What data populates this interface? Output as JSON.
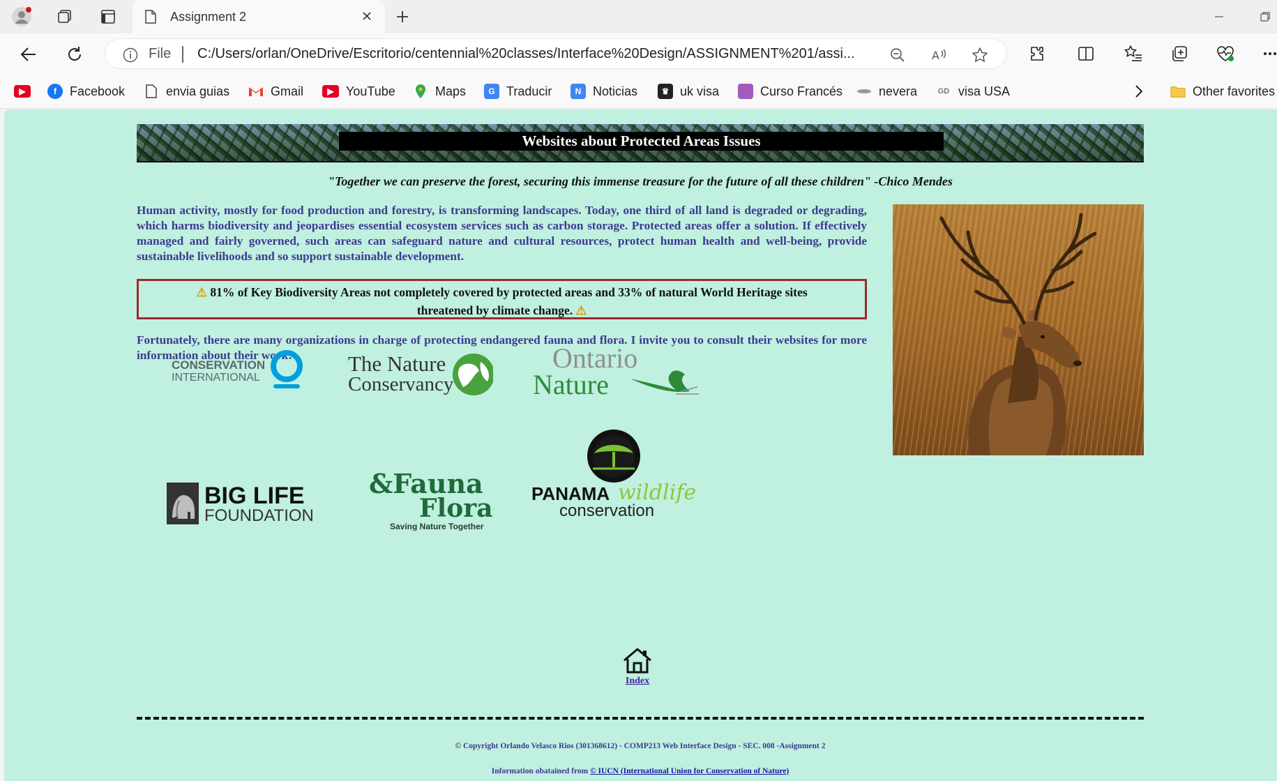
{
  "browser": {
    "tab_title": "Assignment 2",
    "omnibox": {
      "scheme_label": "File",
      "url": "C:/Users/orlan/OneDrive/Escritorio/centennial%20classes/Interface%20Design/ASSIGNMENT%201/assi..."
    },
    "favorites": [
      {
        "label": "Facebook",
        "icon": "facebook-icon"
      },
      {
        "label": "envia guias",
        "icon": "page-icon"
      },
      {
        "label": "Gmail",
        "icon": "gmail-icon"
      },
      {
        "label": "YouTube",
        "icon": "youtube-icon"
      },
      {
        "label": "Maps",
        "icon": "maps-icon"
      },
      {
        "label": "Traducir",
        "icon": "translate-icon"
      },
      {
        "label": "Noticias",
        "icon": "news-icon"
      },
      {
        "label": "uk visa",
        "icon": "uk-visa-icon"
      },
      {
        "label": "Curso Francés",
        "icon": "course-icon"
      },
      {
        "label": "nevera",
        "icon": "nevera-icon"
      },
      {
        "label": "visa USA",
        "icon": "visa-usa-icon"
      }
    ],
    "other_favorites": "Other favorites"
  },
  "page": {
    "banner_title": "Websites about Protected Areas Issues",
    "quote": "\"Together we can preserve the forest, securing this immense treasure for the future of all these children\" -Chico Mendes",
    "intro": "Human activity, mostly for food production and forestry, is transforming landscapes. Today, one third of all land is degraded or degrading, which harms biodiversity and jeopardises essential ecosystem services such as carbon storage. Protected areas offer a solution. If effectively managed and fairly governed, such areas can safeguard nature and cultural resources, protect human health and well-being, provide sustainable livelihoods and so support sustainable development.",
    "alert_line1": "81% of Key Biodiversity Areas not completely covered by protected areas and 33% of natural World Heritage sites",
    "alert_line2": "threatened by climate change.",
    "fortunately": "Fortunately, there are many organizations in charge of protecting endangered fauna and flora. I invite you to consult their websites for more information about their work:",
    "logos": {
      "ci_line1": "CONSERVATION",
      "ci_line2": "INTERNATIONAL",
      "tnc_line1": "The Nature",
      "tnc_line2": "Conservancy",
      "on_line1": "Ontario",
      "on_line2": "Nature",
      "bl_line1": "BIG LIFE",
      "bl_line2": "FOUNDATION",
      "ff_line1": "&Fauna",
      "ff_line2": "Flora",
      "ff_tagline": "Saving Nature Together",
      "pw_line1": "PANAMA",
      "pw_line1b": "wildlife",
      "pw_line2": "conservation"
    },
    "home_label": "Index",
    "copyright": "© Copyright Orlando Velasco Rios (301368612) - COMP213 Web Interface Design - SEC. 008 -Assignment 2",
    "source_prefix": "Information obatained from ",
    "source_link": "© IUCN (International Union for Conservation of Nature)"
  },
  "colors": {
    "page_bg": "#c0f0df",
    "body_text": "#3d3a91",
    "alert_border": "#9b2b2b"
  }
}
